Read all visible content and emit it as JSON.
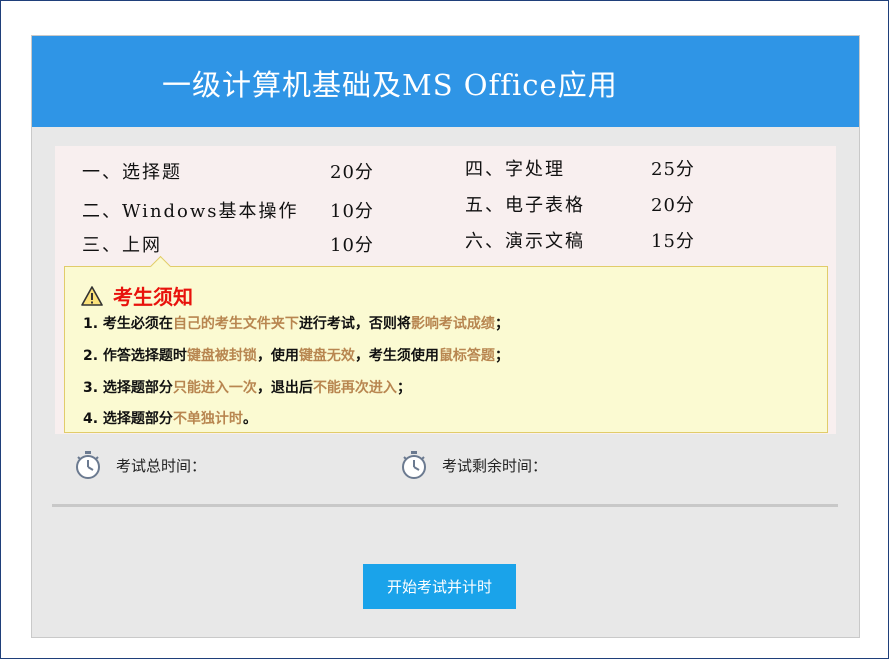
{
  "header": {
    "title": "一级计算机基础及MS Office应用"
  },
  "scores": {
    "left": [
      {
        "name": "一、选择题",
        "points": "20分"
      },
      {
        "name": "二、Windows基本操作",
        "points": "10分"
      },
      {
        "name": "三、上网",
        "points": "10分"
      }
    ],
    "right": [
      {
        "name": "四、字处理",
        "points": "25分"
      },
      {
        "name": "五、电子表格",
        "points": "20分"
      },
      {
        "name": "六、演示文稿",
        "points": "15分"
      }
    ]
  },
  "notice": {
    "title": "考生须知",
    "rule1": {
      "p1": "1. 考生必须在",
      "h1": "自己的考生文件夹下",
      "p2": "进行考试，否则将",
      "h2": "影响考试成绩",
      "p3": "；"
    },
    "rule2": {
      "p1": "2. 作答选择题时",
      "h1": "键盘被封锁",
      "p2": "，使用",
      "h2": "键盘无效",
      "p3": "，考生须使用",
      "h3": "鼠标答题",
      "p4": "；"
    },
    "rule3": {
      "p1": "3. 选择题部分",
      "h1": "只能进入一次",
      "p2": "，退出后",
      "h2": "不能再次进入",
      "p3": "；"
    },
    "rule4": {
      "p1": "4. 选择题部分",
      "h1": "不单独计时",
      "p2": "。"
    }
  },
  "timers": {
    "total_label": "考试总时间：",
    "remaining_label": "考试剩余时间："
  },
  "start_button": {
    "label": "开始考试并计时"
  },
  "colors": {
    "header": "#2f95e6",
    "notice_title": "#e8120c",
    "highlight": "#b88650",
    "button": "#1aa3ea"
  },
  "icons": {
    "warning": "warning-triangle-icon",
    "stopwatch": "stopwatch-icon"
  }
}
